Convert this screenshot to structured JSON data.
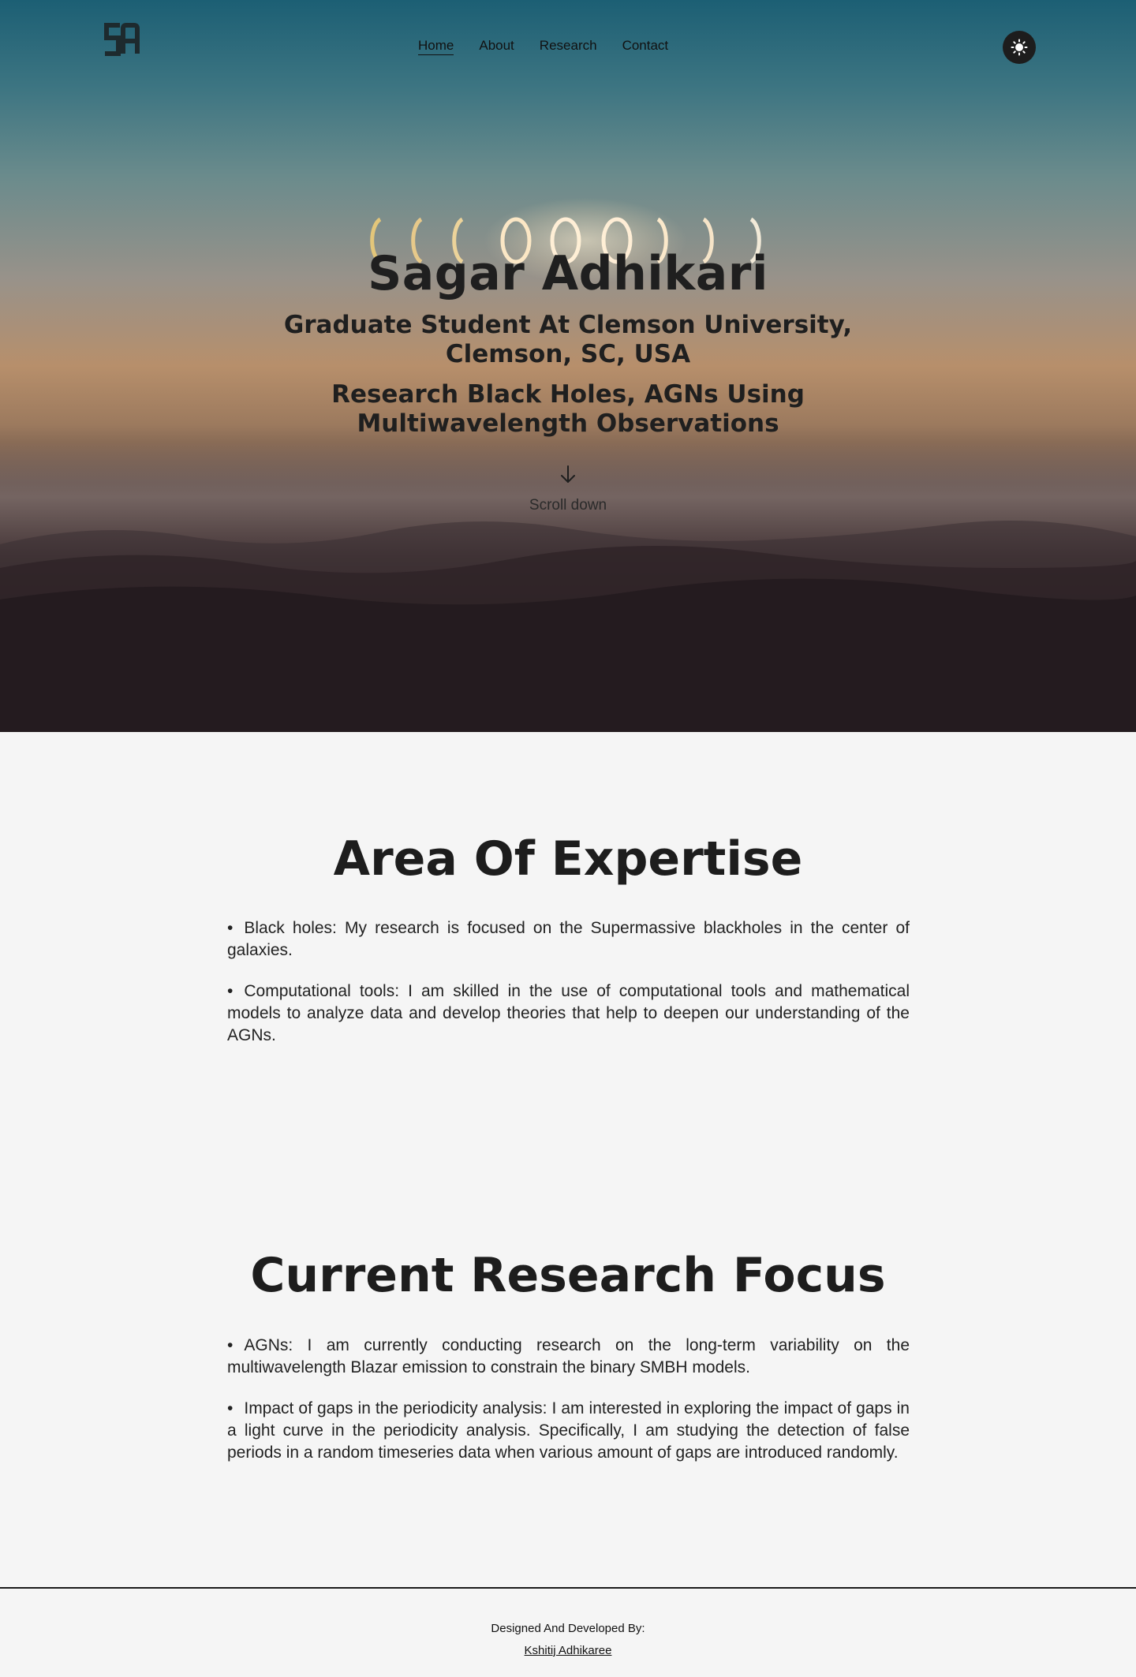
{
  "nav": {
    "logo_text": "SA",
    "links": [
      "Home",
      "About",
      "Research",
      "Contact"
    ],
    "active": "Home",
    "theme_toggle_icon": "sun-icon"
  },
  "hero": {
    "name": "Sagar Adhikari",
    "role_line1": "Graduate Student At Clemson University,",
    "role_line2": "Clemson, SC, USA",
    "research_line1": "Research Black Holes, AGNs Using",
    "research_line2": "Multiwavelength Observations",
    "scroll_icon": "arrow-down-icon",
    "scroll_label": "Scroll down"
  },
  "expertise": {
    "title": "Area Of Expertise",
    "items": [
      "Black holes: My research is focused on the Supermassive blackholes in the center of galaxies.",
      "Computational tools: I am skilled in the use of computational tools and mathematical models to analyze data and develop theories that help to deepen our understanding of the AGNs."
    ]
  },
  "research_focus": {
    "title": "Current Research Focus",
    "items": [
      "AGNs: I am currently conducting research on the long-term variability on the multiwavelength Blazar emission to constrain the binary SMBH models.",
      "Impact of gaps in the periodicity analysis: I am interested in exploring the impact of gaps in a light curve in the periodicity analysis. Specifically, I am studying the detection of false periods in a random timeseries data when various amount of gaps are introduced randomly."
    ]
  },
  "footer": {
    "label": "Designed And Developed By:",
    "author": "Kshitij Adhikaree"
  },
  "colors": {
    "page_background": "#f5f5f5",
    "text": "#1e1e1e",
    "hero_sky_top": "#1c5f74",
    "hero_sunset": "#b78f6b",
    "hero_ground": "#1c1518"
  }
}
